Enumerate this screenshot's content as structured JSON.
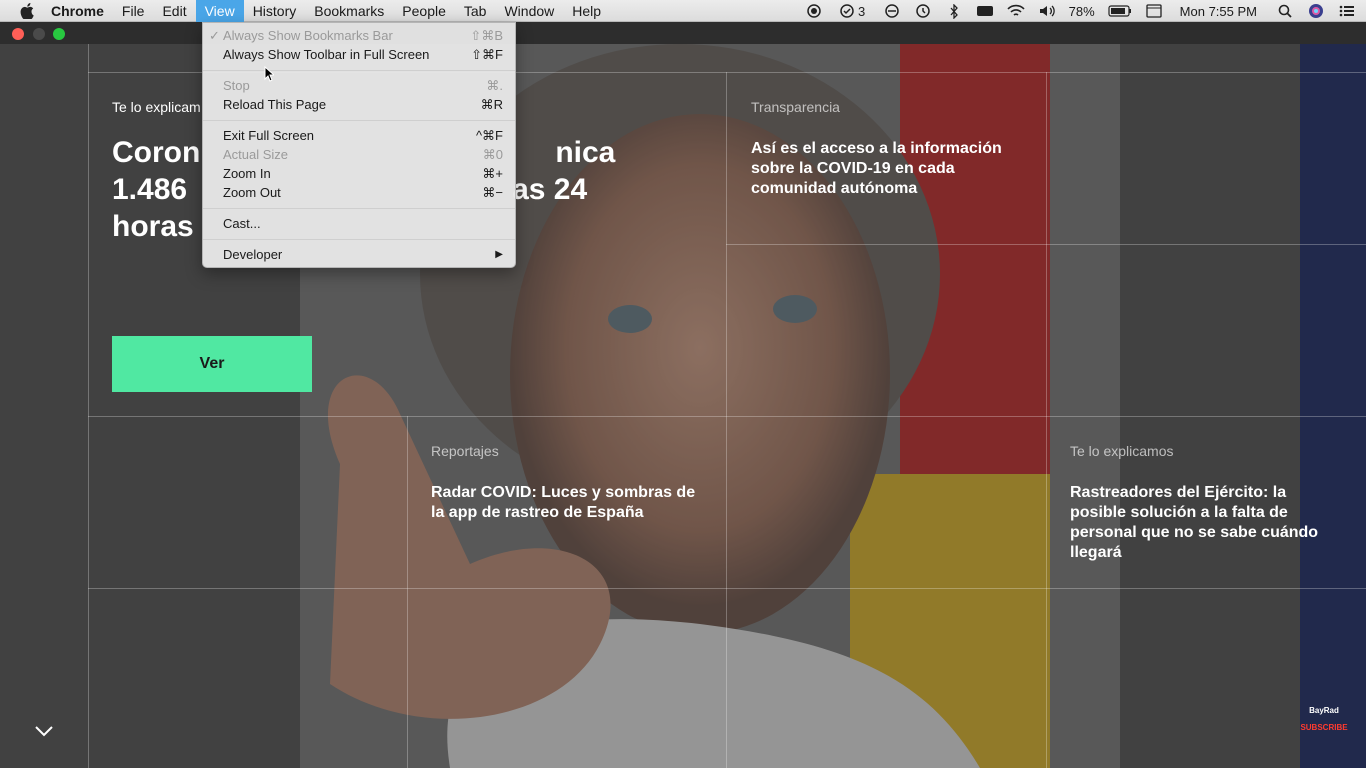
{
  "menubar": {
    "app_name": "Chrome",
    "items": [
      "File",
      "Edit",
      "View",
      "History",
      "Bookmarks",
      "People",
      "Tab",
      "Window",
      "Help"
    ],
    "active_item": "View",
    "status": {
      "badge_count": "3",
      "battery_percent": "78%",
      "clock": "Mon 7:55 PM"
    }
  },
  "view_menu": {
    "items": [
      {
        "label": "Always Show Bookmarks Bar",
        "shortcut": "⇧⌘B",
        "disabled": true,
        "checked": true
      },
      {
        "label": "Always Show Toolbar in Full Screen",
        "shortcut": "⇧⌘F",
        "disabled": false
      },
      {
        "label": "Stop",
        "shortcut": "⌘.",
        "disabled": true
      },
      {
        "label": "Reload This Page",
        "shortcut": "⌘R",
        "disabled": false
      },
      {
        "label": "Exit Full Screen",
        "shortcut": "^⌘F",
        "disabled": false
      },
      {
        "label": "Actual Size",
        "shortcut": "⌘0",
        "disabled": true
      },
      {
        "label": "Zoom In",
        "shortcut": "⌘+",
        "disabled": false
      },
      {
        "label": "Zoom Out",
        "shortcut": "⌘−",
        "disabled": false
      },
      {
        "label": "Cast...",
        "shortcut": "",
        "disabled": false
      },
      {
        "label": "Developer",
        "shortcut": "▶",
        "disabled": false
      }
    ]
  },
  "hero": {
    "kicker": "Te lo explicam",
    "title_line1": "Coron",
    "title_line1b": "nica",
    "title_line2": "1.486",
    "title_line2b": "as 24",
    "title_line3": "horas",
    "button_label": "Ver"
  },
  "articles": [
    {
      "kicker": "Transparencia",
      "headline": "Así es el acceso a la información sobre la COVID-19 en cada comunidad autónoma"
    },
    {
      "kicker": "Reportajes",
      "headline": "Radar COVID: Luces y sombras de la app de rastreo de España"
    },
    {
      "kicker": "Te lo explicamos",
      "headline": "Rastreadores del Ejército: la posible solución a la falta de personal que no se sabe cuándo llegará"
    }
  ],
  "watermark": {
    "brand": "BayRad",
    "subscribe": "SUBSCRIBE"
  },
  "colors": {
    "accent_button": "#50e8a2",
    "menu_active": "#4aa6e8",
    "subscribe": "#ff3b2f"
  }
}
